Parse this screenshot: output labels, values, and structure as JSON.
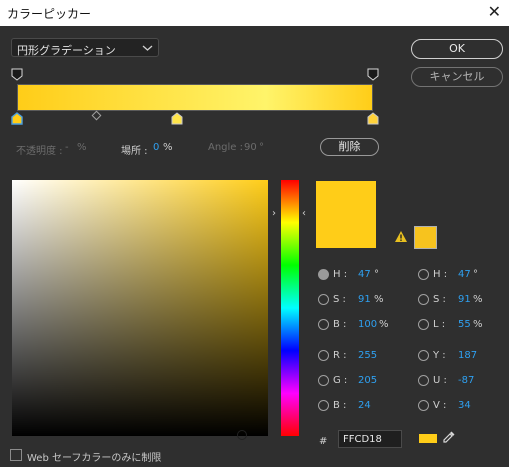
{
  "window": {
    "title": "カラーピッカー"
  },
  "dropdown": {
    "label": "円形グラデーション"
  },
  "buttons": {
    "ok": "OK",
    "cancel": "キャンセル",
    "delete": "削除"
  },
  "stop_row": {
    "opacity_label": "不透明度 :",
    "opacity_value": "-",
    "opacity_unit": "%",
    "location_label": "場所 :",
    "location_value": "0",
    "location_unit": "%",
    "angle_label": "Angle :",
    "angle_value": "90",
    "angle_unit": "°"
  },
  "colors": {
    "current": "#FFCD18",
    "gamut": "#F7C31E",
    "gradient_start": "#FFCD18",
    "gradient_end": "#FFF46A"
  },
  "hsb": [
    {
      "label": "H :",
      "value": "47",
      "unit": "°",
      "selected": true
    },
    {
      "label": "S :",
      "value": "91",
      "unit": "%"
    },
    {
      "label": "B :",
      "value": "100",
      "unit": "%"
    }
  ],
  "hsl": [
    {
      "label": "H :",
      "value": "47",
      "unit": "°"
    },
    {
      "label": "S :",
      "value": "91",
      "unit": "%"
    },
    {
      "label": "L :",
      "value": "55",
      "unit": "%"
    }
  ],
  "rgb": [
    {
      "label": "R :",
      "value": "255"
    },
    {
      "label": "G :",
      "value": "205"
    },
    {
      "label": "B :",
      "value": "24"
    }
  ],
  "yuv": [
    {
      "label": "Y :",
      "value": "187"
    },
    {
      "label": "U :",
      "value": "-87"
    },
    {
      "label": "V :",
      "value": "34"
    }
  ],
  "hex": {
    "symbol": "#",
    "value": "FFCD18"
  },
  "web_only": {
    "label": "Web セーフカラーのみに制限",
    "checked": false
  }
}
